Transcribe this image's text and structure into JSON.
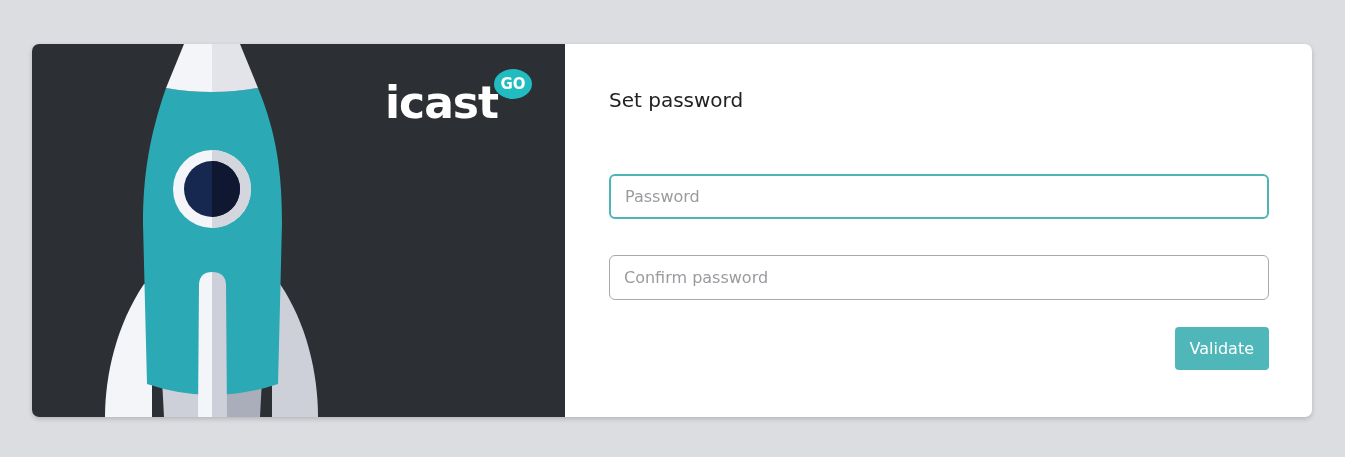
{
  "logo": {
    "text": "icast",
    "badge": "GO"
  },
  "form": {
    "title": "Set password",
    "fields": [
      {
        "placeholder": "Password",
        "focused": true
      },
      {
        "placeholder": "Confirm password",
        "focused": false
      }
    ],
    "submit": {
      "label": "Validate"
    }
  }
}
